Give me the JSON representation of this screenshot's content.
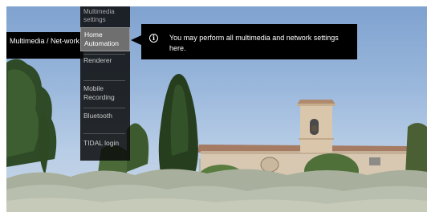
{
  "side_label": "Multimedia / Net-work",
  "menu": {
    "header": "Multimedia settings",
    "items": [
      {
        "label": "Home Automation",
        "active": true
      },
      {
        "label": "Renderer"
      },
      {
        "label": "Mobile Recording"
      },
      {
        "label": "Bluetooth"
      },
      {
        "label": "TIDAL login"
      }
    ]
  },
  "info": {
    "icon": "info-icon",
    "text": "You may perform all multimedia and network settings here."
  }
}
